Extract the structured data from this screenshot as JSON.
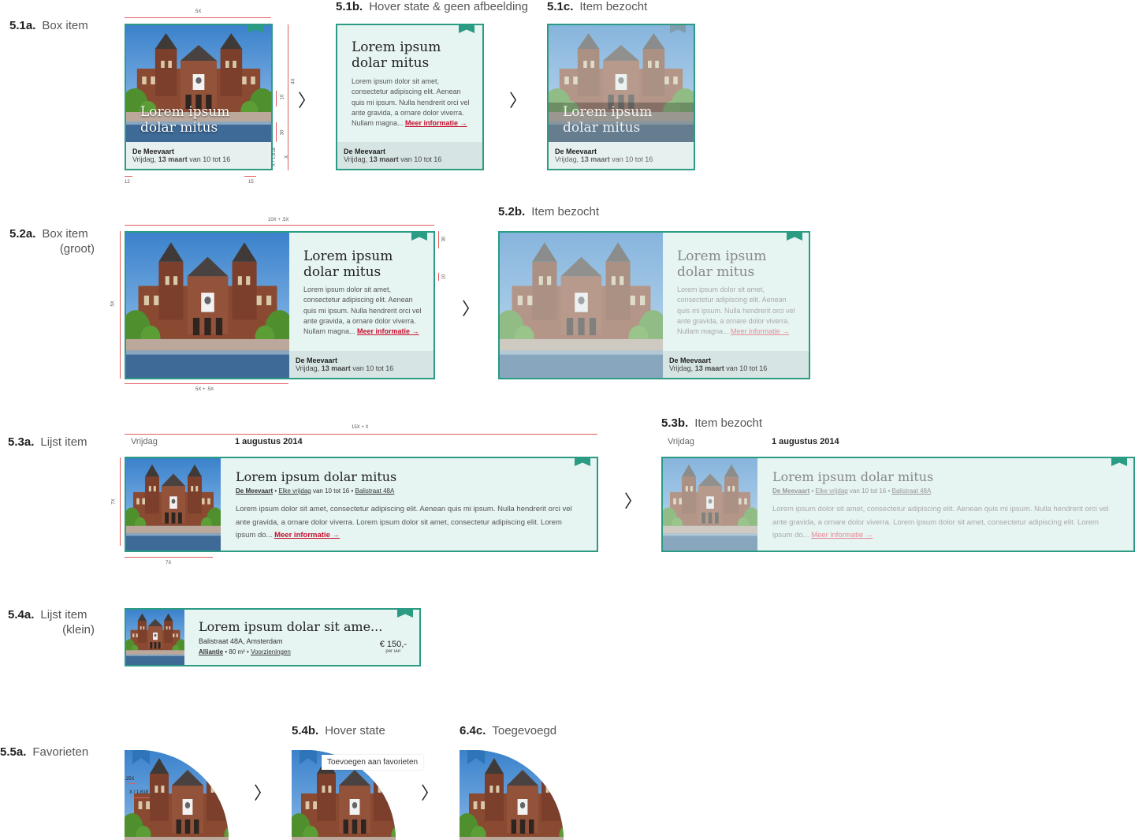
{
  "colors": {
    "accent": "#2b9b84",
    "link": "#c8102e",
    "card_bg": "#e6f4f2",
    "footer_bg": "#d6e5e3",
    "dimension": "#e25c5c",
    "favorite": "#2d74b8"
  },
  "card": {
    "title_line1": "Lorem ipsum",
    "title_line2": "dolar mitus",
    "body_box": "Lorem ipsum dolor sit amet, consectetur adipiscing elit. Aenean quis mi ipsum. Nulla hendrerit orci vel ante gravida, a ornare dolor viverra. Nullam magna...",
    "more_link": "Meer informatie",
    "arrow_glyph": "→",
    "location": "De Meevaart",
    "date_prefix": "Vrijdag,",
    "date_bold": "13 maart",
    "date_suffix": "van 10 tot 16"
  },
  "sections": {
    "s51a": {
      "num": "5.1a.",
      "title": "Box item"
    },
    "s51b": {
      "num": "5.1b.",
      "title": "Hover state & geen afbeelding"
    },
    "s51c": {
      "num": "5.1c.",
      "title": "Item bezocht"
    },
    "s52a": {
      "num": "5.2a.",
      "title_line1": "Box item",
      "title_line2": "(groot)"
    },
    "s52b": {
      "num": "5.2b.",
      "title": "Item bezocht"
    },
    "s53a": {
      "num": "5.3a.",
      "title": "Lijst item"
    },
    "s53b": {
      "num": "5.3b.",
      "title": "Item bezocht"
    },
    "s54a": {
      "num": "5.4a.",
      "title_line1": "Lijst item",
      "title_line2": "(klein)"
    },
    "s55a": {
      "num": "5.5a.",
      "title": "Favorieten"
    },
    "s54b": {
      "num": "5.4b.",
      "title": "Hover state"
    },
    "s64c": {
      "num": "6.4c.",
      "title": "Toegevoegd"
    }
  },
  "dimensions": {
    "d51_top": "5X",
    "d51_4x": "4X",
    "d51_10": "10",
    "d51_30": "30",
    "d51_x": "X",
    "d51_ratio": "X / 1,618",
    "d51_12": "12",
    "d51_15": "15",
    "d52_top": "10X + .5X",
    "d52_left": "5X",
    "d52_bottom": "5X + .5X",
    "d52_30": "30",
    "d52_10": "10",
    "d53_top": "15X + X",
    "d53_left": "7X",
    "d53_bottom": "7X",
    "d55_a": ".25X",
    "d55_b": "X / 1,618"
  },
  "list": {
    "day": "Vrijdag",
    "date": "1 augustus 2014",
    "title": "Lorem ipsum dolar mitus",
    "location": "De Meevaart",
    "recurrence_link": "Elke vrijdag",
    "recurrence_rest": "van 10 tot 16",
    "address": "Balistraat 48A",
    "body": "Lorem ipsum dolor sit amet, consectetur adipiscing elit. Aenean quis mi ipsum. Nulla hendrerit orci vel ante gravida, a ornare dolor viverra. Lorem ipsum dolor sit amet, consectetur adipiscing elit. Lorem ipsum do...",
    "more_link": "Meer informatie"
  },
  "small": {
    "title": "Lorem ipsum dolar sit ame...",
    "address": "Balistraat 48A, Amsterdam",
    "org": "Alliantie",
    "area": "80 m²",
    "facilities": "Voorzieningen",
    "price": "€ 150,-",
    "price_unit": "per uur"
  },
  "favorites": {
    "tooltip": "Toevoegen aan favorieten"
  },
  "arrows": {
    "glyph": "〉"
  }
}
